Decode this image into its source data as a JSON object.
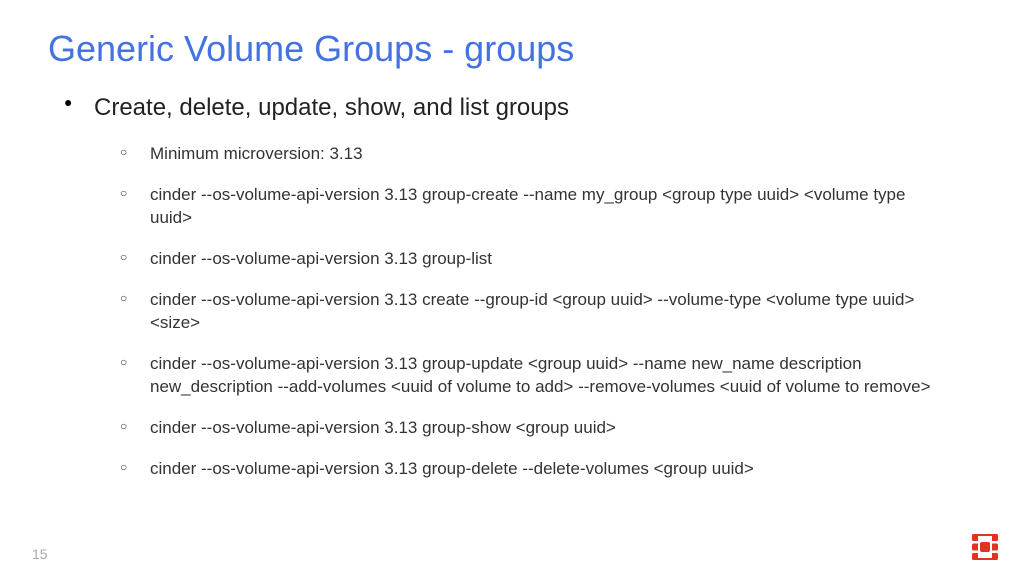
{
  "title": "Generic Volume Groups - groups",
  "main_item": "Create, delete, update, show, and list groups",
  "sub_items": [
    "Minimum microversion: 3.13",
    "cinder --os-volume-api-version 3.13 group-create --name my_group <group type uuid> <volume type uuid>",
    "cinder --os-volume-api-version 3.13 group-list",
    "cinder --os-volume-api-version 3.13 create --group-id <group uuid> --volume-type <volume type uuid> <size>",
    "cinder --os-volume-api-version 3.13 group-update <group uuid> --name new_name description new_description --add-volumes <uuid of volume to add> --remove-volumes <uuid of volume to remove>",
    "cinder --os-volume-api-version 3.13 group-show <group uuid>",
    "cinder --os-volume-api-version 3.13 group-delete --delete-volumes <group uuid>"
  ],
  "page_number": "15"
}
